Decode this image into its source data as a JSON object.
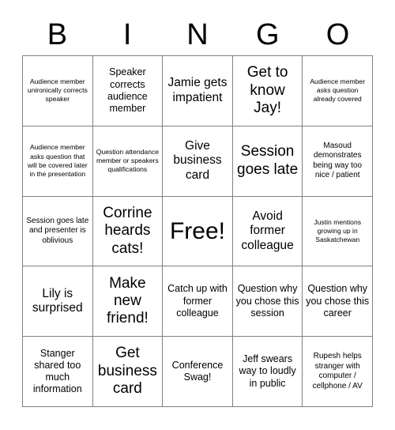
{
  "header": {
    "letters": [
      "B",
      "I",
      "N",
      "G",
      "O"
    ]
  },
  "style": {
    "border_color": "#808080",
    "text_color": "#000000",
    "background": "#ffffff"
  },
  "grid": {
    "columns": 5,
    "rows": 5,
    "cells": [
      {
        "text": "Audience member unironically corrects speaker",
        "size": "xs"
      },
      {
        "text": "Speaker corrects audience member",
        "size": "m"
      },
      {
        "text": "Jamie gets impatient",
        "size": "l"
      },
      {
        "text": "Get to know Jay!",
        "size": "xl"
      },
      {
        "text": "Audience member asks question already covered",
        "size": "xs"
      },
      {
        "text": "Audience member asks question that will be covered later in the presentation",
        "size": "xs"
      },
      {
        "text": "Question attendance member or speakers qualifications",
        "size": "xs"
      },
      {
        "text": "Give business card",
        "size": "l"
      },
      {
        "text": "Session goes late",
        "size": "xl"
      },
      {
        "text": "Masoud demonstrates being way too nice / patient",
        "size": "s"
      },
      {
        "text": "Session goes late and presenter is oblivious",
        "size": "s"
      },
      {
        "text": "Corrine heards cats!",
        "size": "xl"
      },
      {
        "text": "Free!",
        "size": "free"
      },
      {
        "text": "Avoid former colleague",
        "size": "l"
      },
      {
        "text": "Justin mentions growing up in Saskatchewan",
        "size": "xs"
      },
      {
        "text": "Lily is surprised",
        "size": "l"
      },
      {
        "text": "Make new friend!",
        "size": "xl"
      },
      {
        "text": "Catch up with former colleague",
        "size": "m"
      },
      {
        "text": "Question why you chose this session",
        "size": "m"
      },
      {
        "text": "Question why you chose this career",
        "size": "m"
      },
      {
        "text": "Stanger shared too much information",
        "size": "m"
      },
      {
        "text": "Get business card",
        "size": "xl"
      },
      {
        "text": "Conference Swag!",
        "size": "m"
      },
      {
        "text": "Jeff swears way to loudly in public",
        "size": "m"
      },
      {
        "text": "Rupesh helps stranger with computer / cellphone / AV",
        "size": "s"
      }
    ]
  }
}
